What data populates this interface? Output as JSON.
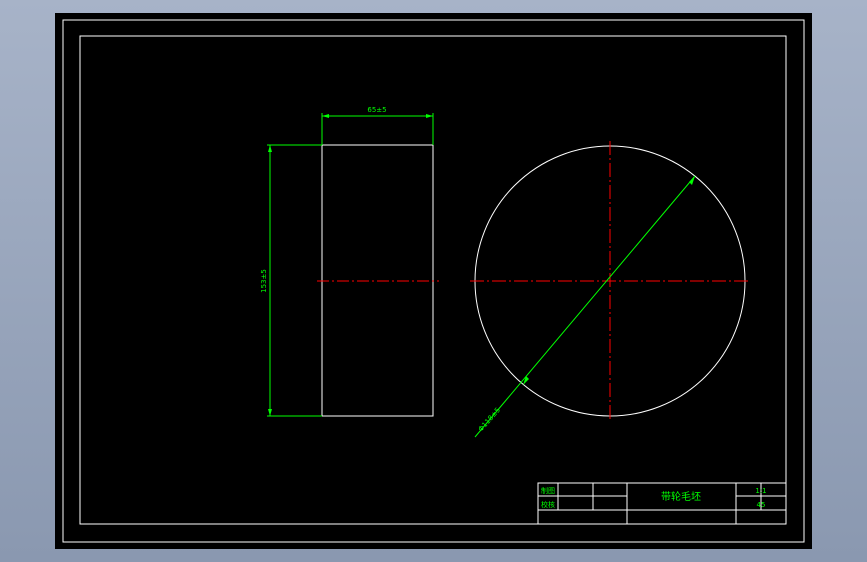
{
  "drawing": {
    "dimensions": {
      "width_label": "65±5",
      "height_label": "153±5",
      "diameter_label": "Φ118±5"
    },
    "title_block": {
      "row1_label": "制图",
      "row2_label": "校核",
      "part_name": "带轮毛坯",
      "scale": "1:1",
      "material": "45"
    },
    "colors": {
      "outline": "#ffffff",
      "dimension": "#00ff00",
      "centerline": "#ff0000",
      "background": "#000000"
    }
  }
}
